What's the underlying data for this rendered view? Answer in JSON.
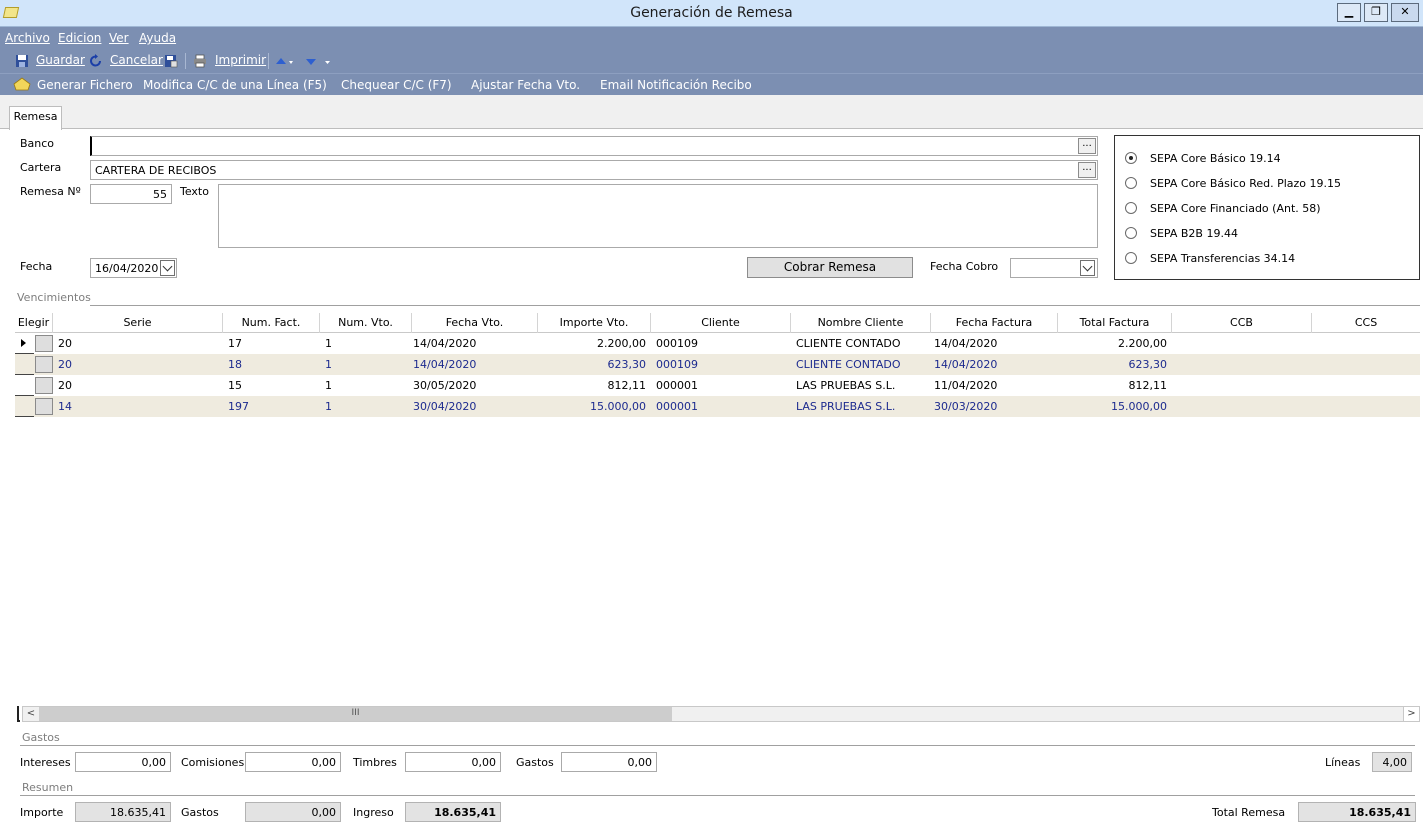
{
  "window": {
    "title": "Generación de Remesa",
    "min": "▁",
    "restore": "❐",
    "close": "✕"
  },
  "menu": [
    "Archivo",
    "Edicion",
    "Ver",
    "Ayuda"
  ],
  "toolbar": {
    "save": "Guardar",
    "cancel": "Cancelar",
    "print": "Imprimir"
  },
  "actions": [
    "Generar Fichero",
    "Modifica C/C de una Línea (F5)",
    "Chequear C/C (F7)",
    "Ajustar Fecha Vto.",
    "Email Notificación Recibo"
  ],
  "tabs": [
    "Remesa"
  ],
  "form": {
    "banco_label": "Banco",
    "banco_value": "",
    "cartera_label": "Cartera",
    "cartera_value": "CARTERA DE RECIBOS",
    "remesa_label": "Remesa Nº",
    "remesa_value": "55",
    "texto_label": "Texto",
    "texto_value": "",
    "fecha_label": "Fecha",
    "fecha_value": "16/04/2020",
    "cobrar_button": "Cobrar Remesa",
    "fecha_cobro_label": "Fecha Cobro",
    "fecha_cobro_value": "",
    "ellipsis": "..."
  },
  "sepa_options": [
    {
      "label": "SEPA Core Básico 19.14",
      "selected": true
    },
    {
      "label": "SEPA Core Básico Red. Plazo 19.15",
      "selected": false
    },
    {
      "label": "SEPA Core Financiado (Ant. 58)",
      "selected": false
    },
    {
      "label": "SEPA B2B 19.44",
      "selected": false
    },
    {
      "label": "SEPA Transferencias 34.14",
      "selected": false
    }
  ],
  "vencimientos": {
    "title": "Vencimientos",
    "columns": [
      "Elegir",
      "Serie",
      "Num. Fact.",
      "Num. Vto.",
      "Fecha Vto.",
      "Importe Vto.",
      "Cliente",
      "Nombre Cliente",
      "Fecha Factura",
      "Total Factura",
      "CCB",
      "CCS"
    ],
    "rows": [
      [
        "20",
        "17",
        "1",
        "14/04/2020",
        "2.200,00",
        "000109",
        "CLIENTE CONTADO",
        "14/04/2020",
        "2.200,00",
        "",
        ""
      ],
      [
        "20",
        "18",
        "1",
        "14/04/2020",
        "623,30",
        "000109",
        "CLIENTE CONTADO",
        "14/04/2020",
        "623,30",
        "",
        ""
      ],
      [
        "20",
        "15",
        "1",
        "30/05/2020",
        "812,11",
        "000001",
        "LAS PRUEBAS S.L.",
        "11/04/2020",
        "812,11",
        "",
        ""
      ],
      [
        "14",
        "197",
        "1",
        "30/04/2020",
        "15.000,00",
        "000001",
        "LAS PRUEBAS S.L.",
        "30/03/2020",
        "15.000,00",
        "",
        ""
      ]
    ]
  },
  "scroll": {
    "left": "<",
    "right": ">",
    "thumb": "III"
  },
  "gastos": {
    "title": "Gastos",
    "intereses_label": "Intereses",
    "intereses": "0,00",
    "comisiones_label": "Comisiones",
    "comisiones": "0,00",
    "timbres_label": "Timbres",
    "timbres": "0,00",
    "gastos_label": "Gastos",
    "gastos": "0,00",
    "lineas_label": "Líneas",
    "lineas": "4,00"
  },
  "resumen": {
    "title": "Resumen",
    "importe_label": "Importe",
    "importe": "18.635,41",
    "gastos_label": "Gastos",
    "gastos": "0,00",
    "ingreso_label": "Ingreso",
    "ingreso": "18.635,41",
    "total_label": "Total Remesa",
    "total": "18.635,41"
  }
}
